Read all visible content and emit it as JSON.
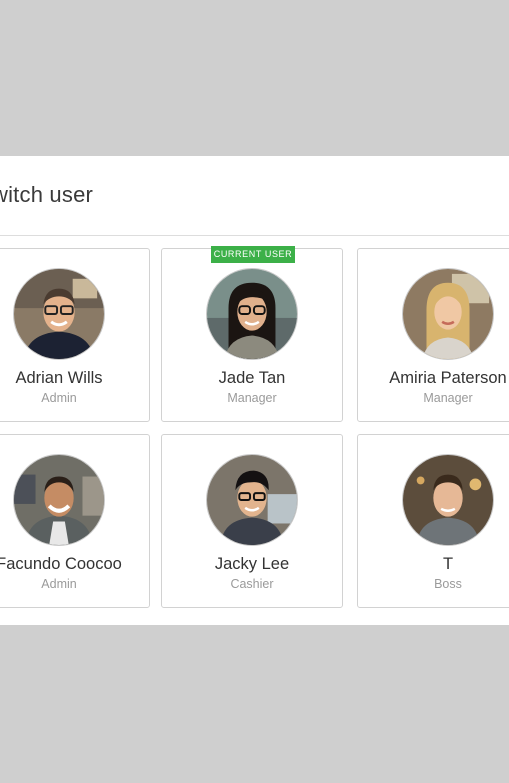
{
  "dialog": {
    "title": "witch user",
    "current_user_badge": "CURRENT USER"
  },
  "users": [
    {
      "name": "Adrian Wills",
      "role": "Admin",
      "current": false
    },
    {
      "name": "Jade Tan",
      "role": "Manager",
      "current": true
    },
    {
      "name": "Amiria Paterson",
      "role": "Manager",
      "current": false
    },
    {
      "name": "Facundo Coocoo",
      "role": "Admin",
      "current": false
    },
    {
      "name": "Jacky Lee",
      "role": "Cashier",
      "current": false
    },
    {
      "name": "T",
      "role": "Boss",
      "current": false
    }
  ],
  "colors": {
    "badge_green": "#3cb048",
    "backdrop": "#cfcfcf",
    "card_border": "#d2d2d2"
  }
}
